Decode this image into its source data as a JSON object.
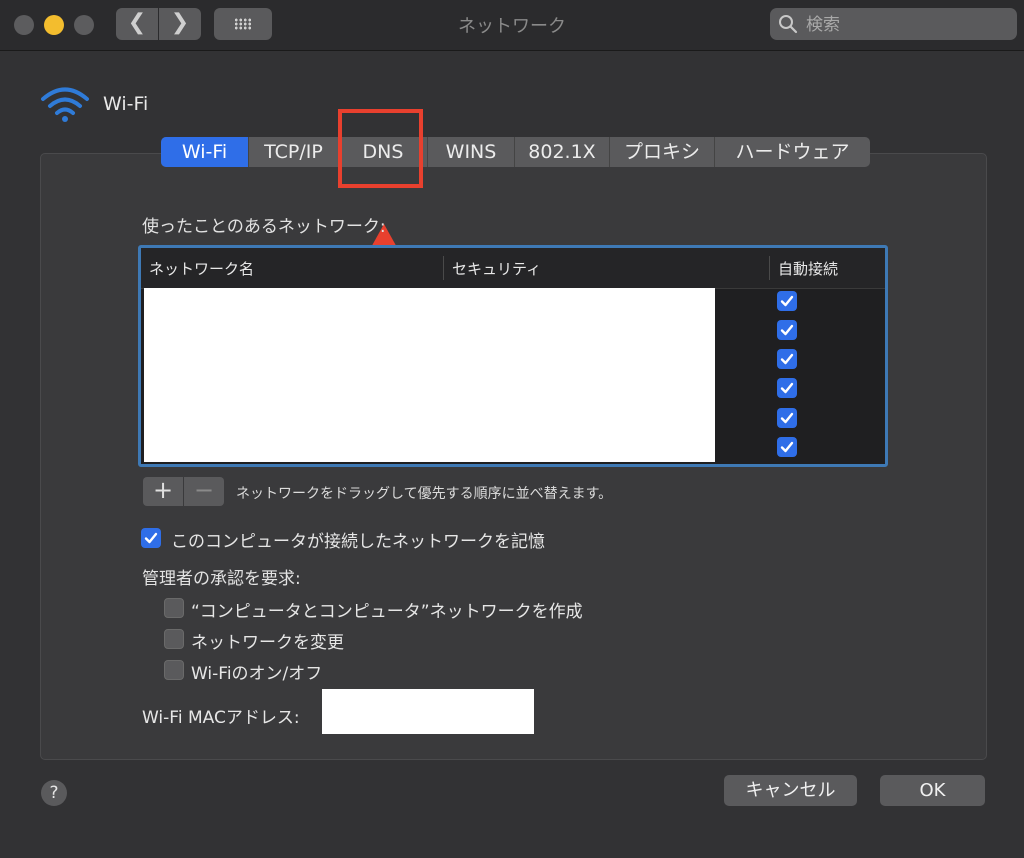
{
  "window": {
    "title": "ネットワーク",
    "search_placeholder": "検索",
    "back_glyph": "❮",
    "forward_glyph": "❯"
  },
  "header": {
    "title": "Wi-Fi"
  },
  "tabs": [
    {
      "label": "Wi-Fi",
      "active": true
    },
    {
      "label": "TCP/IP",
      "active": false
    },
    {
      "label": "DNS",
      "active": false
    },
    {
      "label": "WINS",
      "active": false
    },
    {
      "label": "802.1X",
      "active": false
    },
    {
      "label": "プロキシ",
      "active": false
    },
    {
      "label": "ハードウェア",
      "active": false
    }
  ],
  "networks": {
    "section_label": "使ったことのあるネットワーク:",
    "columns": [
      "ネットワーク名",
      "セキュリティ",
      "自動接続"
    ],
    "auto_join": [
      true,
      true,
      true,
      true,
      true,
      true
    ],
    "add_glyph": "+",
    "remove_glyph": "−",
    "hint": "ネットワークをドラッグして優先する順序に並べ替えます。"
  },
  "options": {
    "remember_label": "このコンピュータが接続したネットワークを記憶",
    "remember_checked": true,
    "admin_label": "管理者の承認を要求:",
    "admin_items": [
      {
        "label": "“コンピュータとコンピュータ”ネットワークを作成",
        "checked": false
      },
      {
        "label": "ネットワークを変更",
        "checked": false
      },
      {
        "label": "Wi-Fiのオン/オフ",
        "checked": false
      }
    ],
    "mac_label": "Wi-Fi MACアドレス:"
  },
  "footer": {
    "help_glyph": "?",
    "cancel_label": "キャンセル",
    "ok_label": "OK"
  },
  "colors": {
    "accent": "#2f6ee8",
    "annotation": "#e8402e"
  },
  "icons": [
    "wifi-icon",
    "search-icon",
    "grid-icon",
    "checkmark-icon",
    "help-icon"
  ]
}
